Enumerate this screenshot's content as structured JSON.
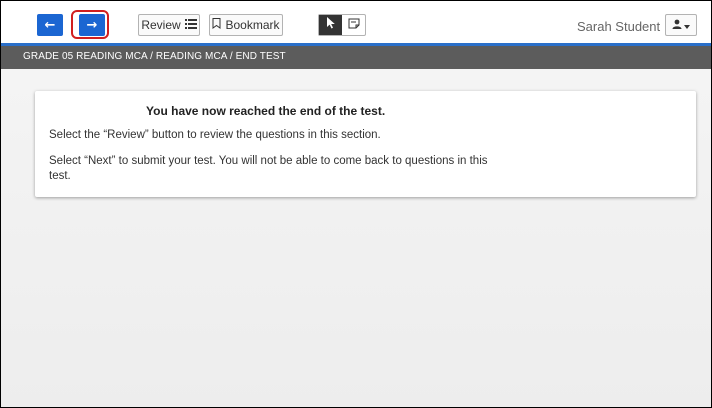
{
  "toolbar": {
    "back_icon": "arrow-left-icon",
    "back_glyph": "←",
    "next_icon": "arrow-right-icon",
    "next_glyph": "→",
    "review_label": "Review",
    "review_icon": "list-icon",
    "bookmark_label": "Bookmark",
    "bookmark_icon": "bookmark-icon",
    "pointer_tool_icon": "pointer-icon",
    "note_tool_icon": "sticky-note-icon",
    "user_name": "Sarah Student",
    "user_menu_icon": "user-icon",
    "highlighted_control": "next-button",
    "accent_color": "#1b66d2",
    "highlight_color": "#d11f1f"
  },
  "breadcrumb": {
    "text": "GRADE 05 READING MCA / READING MCA / END TEST"
  },
  "message": {
    "title": "You have now reached the end of the test.",
    "review_instruction": "Select the “Review” button to review the questions in this section.",
    "next_instruction": "Select “Next” to submit your test. You will not be able to come back to questions in this test."
  }
}
